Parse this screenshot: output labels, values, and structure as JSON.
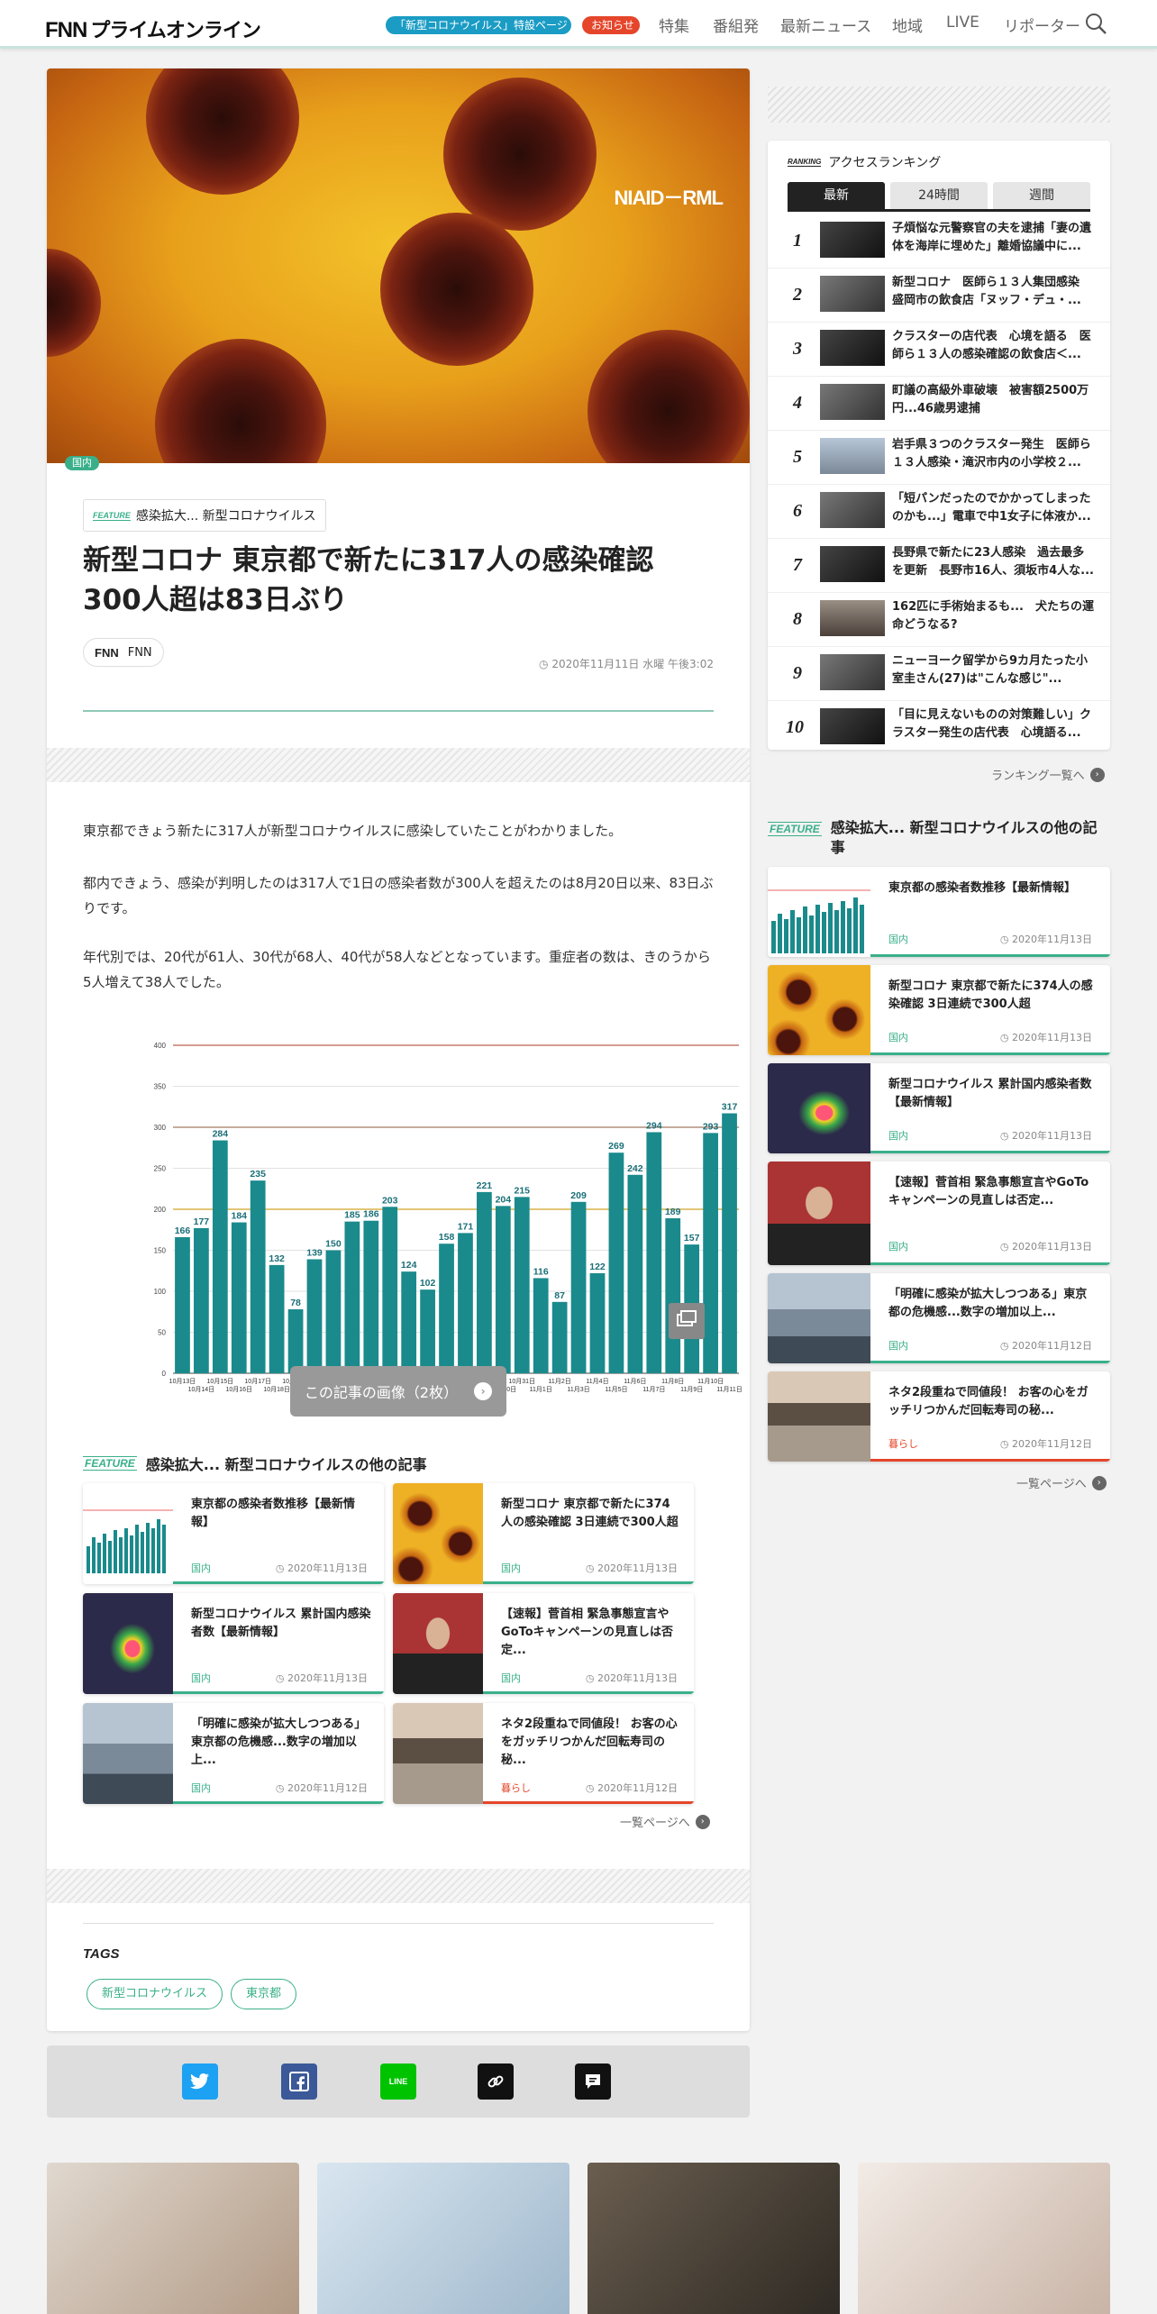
{
  "header": {
    "logo_fnn": "FNN",
    "logo_text": "プライムオンライン",
    "special_pill": "「新型コロナウイルス」特設ページ",
    "notice_pill": "お知らせ",
    "nav": [
      "特集",
      "番組発",
      "最新ニュース",
      "地域",
      "LIVE",
      "リポーター"
    ]
  },
  "article": {
    "hero_credit": "NIAID－RML",
    "category": "国内",
    "feature_tag": "FEATURE",
    "feature_name": "感染拡大... 新型コロナウイルス",
    "title_line1": "新型コロナ 東京都で新たに317人の感染確認",
    "title_line2": "300人超は83日ぶり",
    "source_logo": "FNN",
    "source": "FNN",
    "date": "2020年11月11日 水曜 午後3:02",
    "paragraphs": [
      "東京都できょう新たに317人が新型コロナウイルスに感染していたことがわかりました。",
      "都内できょう、感染が判明したのは317人で1日の感染者数が300人を超えたのは8月20日以来、83日ぶりです。",
      "年代別では、20代が61人、30代が68人、40代が58人などとなっています。重症者の数は、きのうから5人増えて38人でした。"
    ],
    "gallery_button": "この記事の画像（2枚）"
  },
  "chart_data": {
    "type": "bar",
    "categories": [
      "10月13日",
      "10月14日",
      "10月15日",
      "10月16日",
      "10月17日",
      "10月18日",
      "10月19日",
      "10月20日",
      "10月21日",
      "10月22日",
      "10月23日",
      "10月24日",
      "10月25日",
      "10月26日",
      "10月27日",
      "10月28日",
      "10月29日",
      "10月30日",
      "10月31日",
      "11月1日",
      "11月2日",
      "11月3日",
      "11月4日",
      "11月5日",
      "11月6日",
      "11月7日",
      "11月8日",
      "11月9日",
      "11月10日",
      "11月11日"
    ],
    "values": [
      166,
      177,
      284,
      184,
      235,
      132,
      78,
      139,
      150,
      185,
      186,
      203,
      124,
      102,
      158,
      171,
      221,
      204,
      215,
      116,
      87,
      209,
      122,
      269,
      242,
      294,
      189,
      157,
      293,
      317
    ],
    "yticks": [
      0,
      50,
      100,
      150,
      200,
      250,
      300,
      350,
      400
    ],
    "ylim": [
      0,
      400
    ],
    "reference_lines": [
      200,
      300,
      400
    ],
    "bar_color": "#1a8a8c"
  },
  "related": {
    "feature_tag": "FEATURE",
    "heading": "感染拡大... 新型コロナウイルスの他の記事",
    "items": [
      {
        "title": "東京都の感染者数推移【最新情報】",
        "cat": "国内",
        "date": "2020年11月13日"
      },
      {
        "title": "新型コロナ 東京都で新たに374人の感染確認 3日連続で300人超",
        "cat": "国内",
        "date": "2020年11月13日"
      },
      {
        "title": "新型コロナウイルス 累計国内感染者数【最新情報】",
        "cat": "国内",
        "date": "2020年11月13日"
      },
      {
        "title": "【速報】菅首相 緊急事態宣言やGoToキャンペーンの見直しは否定...",
        "cat": "国内",
        "date": "2020年11月13日"
      },
      {
        "title": "「明確に感染が拡大しつつある」東京都の危機感...数字の増加以上...",
        "cat": "国内",
        "date": "2020年11月12日"
      },
      {
        "title": "ネタ2段重ねで同値段！ お客の心をガッチリつかんだ回転寿司の秘...",
        "cat": "暮らし",
        "date": "2020年11月12日"
      }
    ],
    "more": "一覧ページへ"
  },
  "tags": {
    "title": "TAGS",
    "items": [
      "新型コロナウイルス",
      "東京都"
    ]
  },
  "share": {
    "icons": [
      "twitter-icon",
      "facebook-icon",
      "line-icon",
      "link-icon",
      "comment-icon"
    ],
    "labels": [
      "t",
      "f",
      "LINE",
      "∞",
      "■"
    ]
  },
  "ranking": {
    "tag": "RANKING",
    "heading": "アクセスランキング",
    "tabs": [
      "最新",
      "24時間",
      "週間"
    ],
    "items": [
      {
        "num": "1",
        "title": "子煩悩な元警察官の夫を逮捕「妻の遺体を海岸に埋めた」離婚協議中に..."
      },
      {
        "num": "2",
        "title": "新型コロナ　医師ら１３人集団感染　盛岡市の飲食店「ヌッフ・デュ・..."
      },
      {
        "num": "3",
        "title": "クラスターの店代表　心境を語る　医師ら１３人の感染確認の飲食店＜..."
      },
      {
        "num": "4",
        "title": "町議の高級外車破壊　被害額2500万円...46歳男逮捕"
      },
      {
        "num": "5",
        "title": "岩手県３つのクラスター発生　医師ら１３人感染・滝沢市内の小学校２..."
      },
      {
        "num": "6",
        "title": "「短パンだったのでかかってしまったのかも...」電車で中1女子に体液か..."
      },
      {
        "num": "7",
        "title": "長野県で新たに23人感染　過去最多を更新　長野市16人、須坂市4人な..."
      },
      {
        "num": "8",
        "title": "162匹に手術始まるも...　犬たちの運命どうなる?"
      },
      {
        "num": "9",
        "title": "ニューヨーク留学から9カ月たった小室圭さん(27)は\"こんな感じ\"..."
      },
      {
        "num": "10",
        "title": "「目に見えないものの対策難しい」クラスター発生の店代表　心境語る..."
      }
    ],
    "more": "ランキング一覧へ"
  },
  "side_feature": {
    "tag": "FEATURE",
    "heading": "感染拡大... 新型コロナウイルスの他の記事",
    "items": [
      {
        "title": "東京都の感染者数推移【最新情報】",
        "cat": "国内",
        "date": "2020年11月13日"
      },
      {
        "title": "新型コロナ 東京都で新たに374人の感染確認 3日連続で300人超",
        "cat": "国内",
        "date": "2020年11月13日"
      },
      {
        "title": "新型コロナウイルス 累計国内感染者数【最新情報】",
        "cat": "国内",
        "date": "2020年11月13日"
      },
      {
        "title": "【速報】菅首相 緊急事態宣言やGoToキャンペーンの見直しは否定...",
        "cat": "国内",
        "date": "2020年11月13日"
      },
      {
        "title": "「明確に感染が拡大しつつある」東京都の危機感...数字の増加以上...",
        "cat": "国内",
        "date": "2020年11月12日"
      },
      {
        "title": "ネタ2段重ねで同値段！ お客の心をガッチリつかんだ回転寿司の秘...",
        "cat": "暮らし",
        "date": "2020年11月12日"
      }
    ],
    "more": "一覧ページへ"
  },
  "colors": {
    "accent_green": "#3ab08a",
    "kurashi_red": "#e5452a",
    "twitter": "#1da1f2",
    "facebook": "#3b5998",
    "line": "#00c300"
  }
}
